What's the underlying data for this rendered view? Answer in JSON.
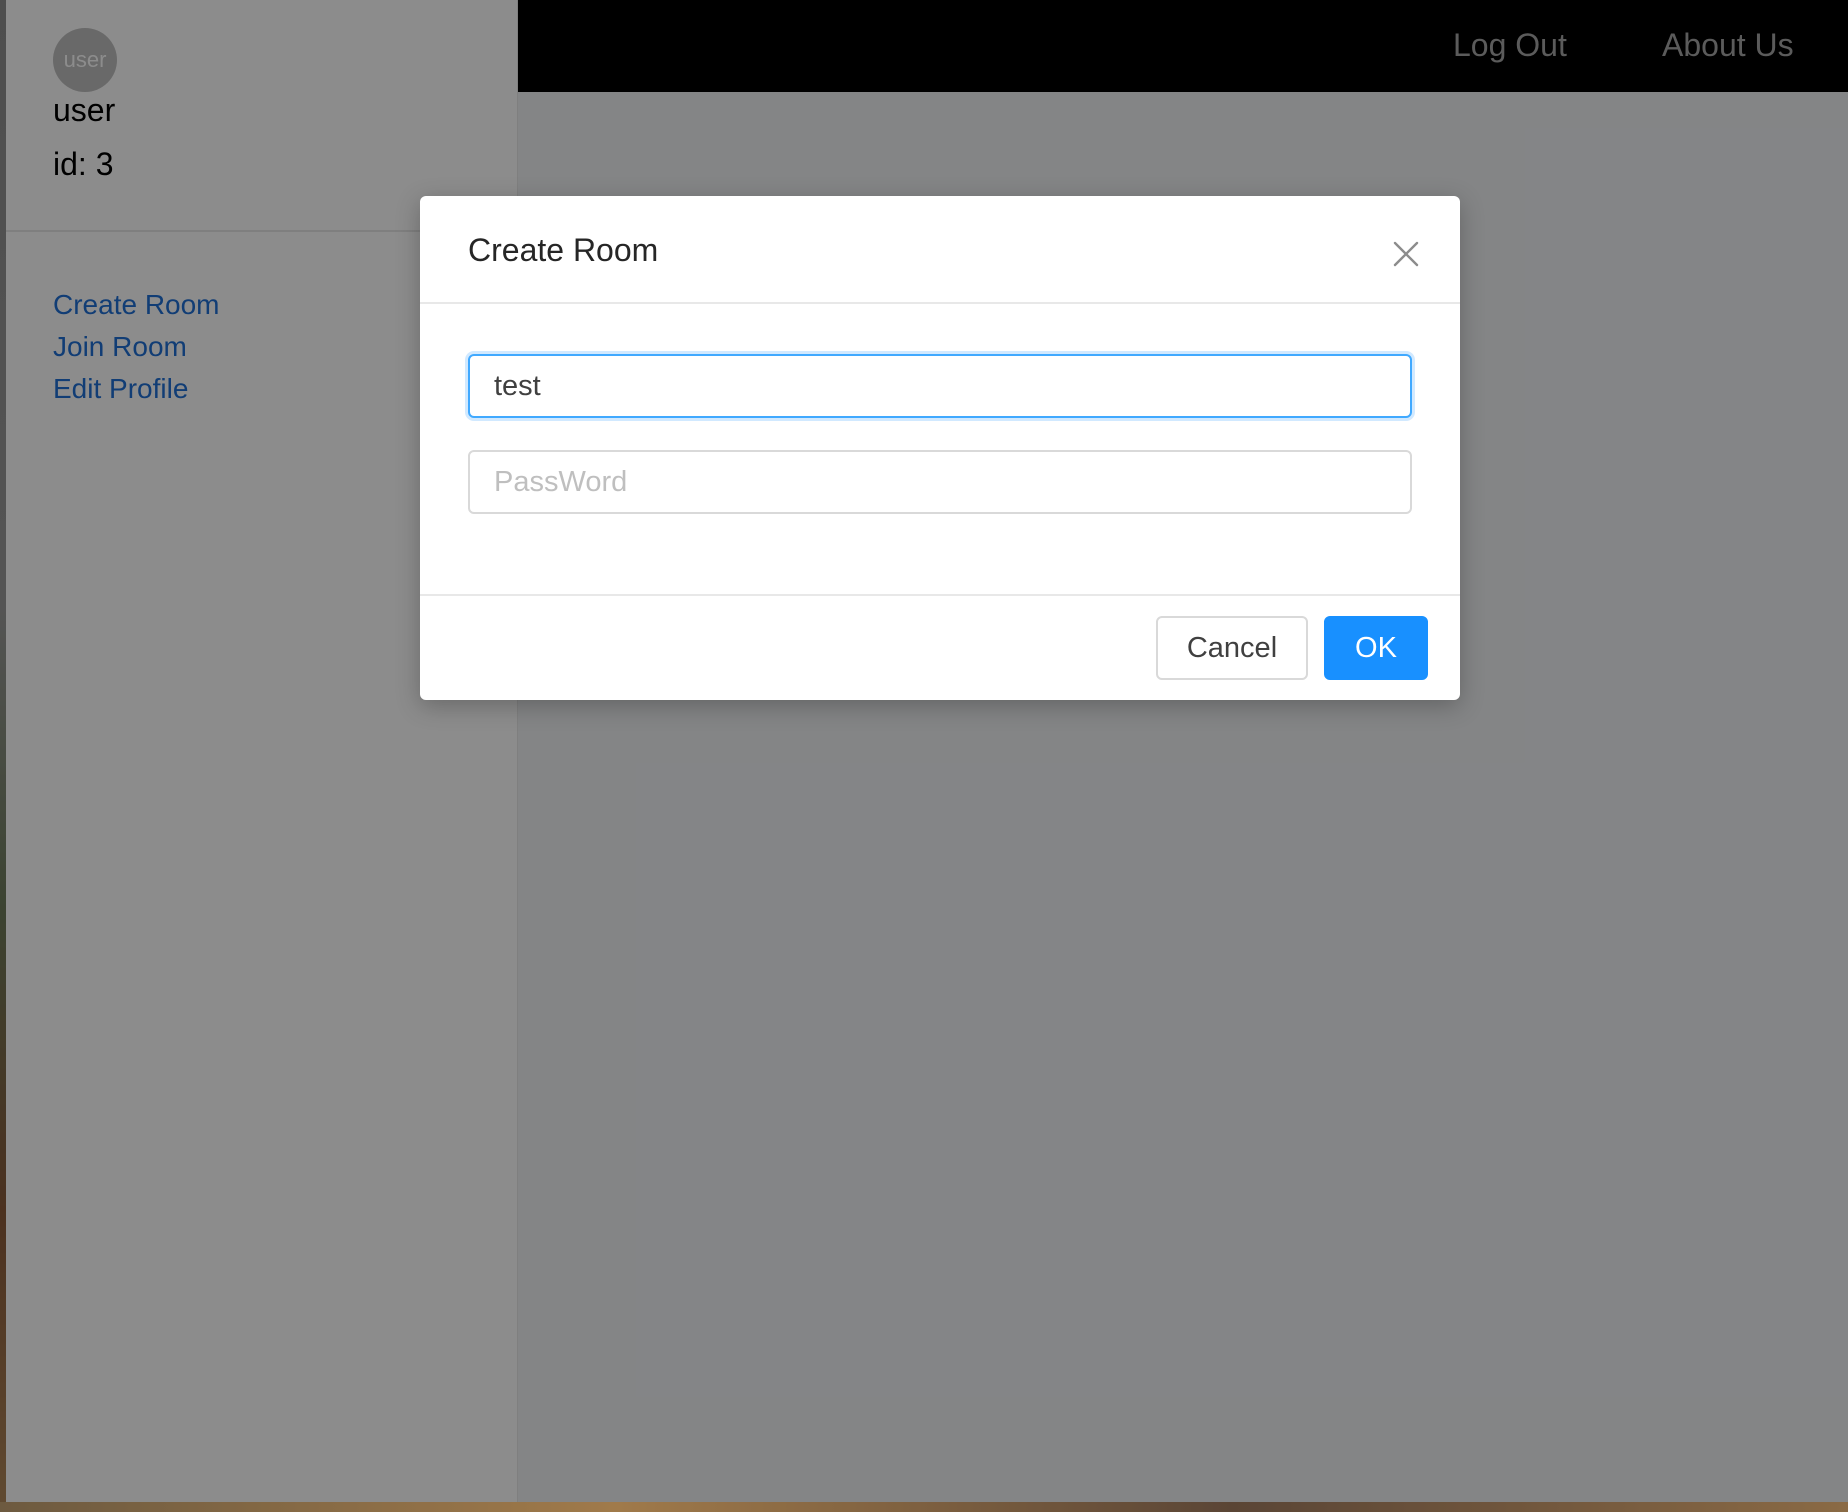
{
  "sidebar": {
    "avatar_text": "user",
    "username": "user",
    "user_id": "id: 3",
    "menu": [
      {
        "label": "Create Room"
      },
      {
        "label": "Join Room"
      },
      {
        "label": "Edit Profile"
      }
    ]
  },
  "topbar": {
    "logout_label": "Log Out",
    "about_label": "About Us"
  },
  "modal": {
    "title": "Create Room",
    "room_name_value": "test",
    "password_placeholder": "PassWord",
    "cancel_label": "Cancel",
    "ok_label": "OK"
  },
  "colors": {
    "link": "#1f6fd6",
    "primary": "#1890ff",
    "topbar_bg": "#000000",
    "topbar_text": "#a6a6a6"
  }
}
